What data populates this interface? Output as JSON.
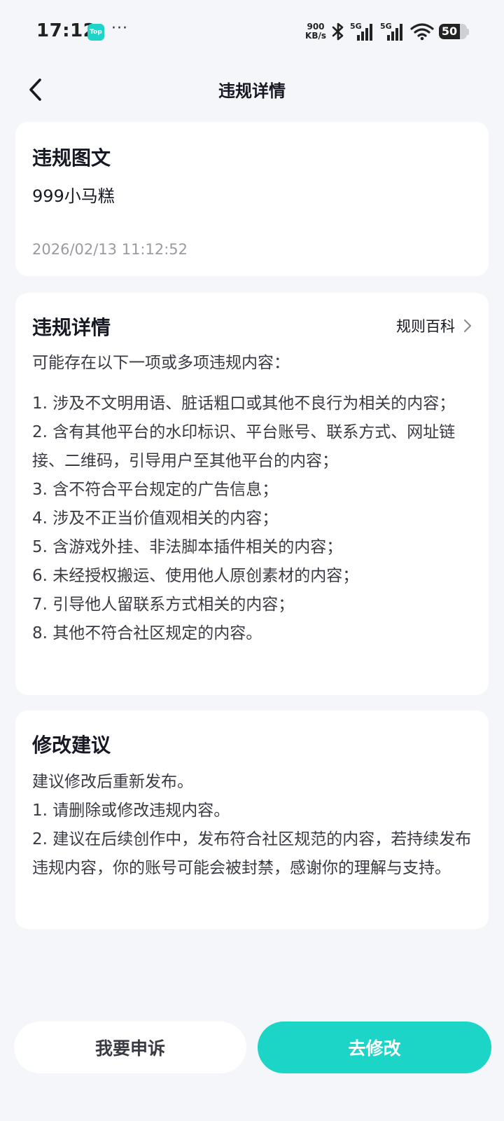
{
  "status_bar": {
    "time": "17:12",
    "top_badge": "Top",
    "more_dots": "···",
    "speed_value": "900",
    "speed_unit": "KB/s",
    "net_1": "5G",
    "net_2": "5G",
    "battery_level": "50"
  },
  "nav": {
    "title": "违规详情"
  },
  "violation_post": {
    "title": "违规图文",
    "name": "999小马糕",
    "time": "2026/02/13 11:12:52"
  },
  "violation_detail": {
    "title": "违规详情",
    "rules_link": "规则百科",
    "intro": "可能存在以下一项或多项违规内容：",
    "items": [
      "1. 涉及不文明用语、脏话粗口或其他不良行为相关的内容；",
      "2. 含有其他平台的水印标识、平台账号、联系方式、网址链接、二维码，引导用户至其他平台的内容；",
      "3. 含不符合平台规定的广告信息；",
      "4. 涉及不正当价值观相关的内容；",
      "5. 含游戏外挂、非法脚本插件相关的内容；",
      "6. 未经授权搬运、使用他人原创素材的内容；",
      "7. 引导他人留联系方式相关的内容；",
      "8. 其他不符合社区规定的内容。"
    ]
  },
  "suggestion": {
    "title": "修改建议",
    "intro": "建议修改后重新发布。",
    "items": [
      "1. 请删除或修改违规内容。",
      "2. 建议在后续创作中，发布符合社区规范的内容，若持续发布违规内容，你的账号可能会被封禁，感谢你的理解与支持。"
    ]
  },
  "actions": {
    "appeal_label": "我要申诉",
    "modify_label": "去修改"
  },
  "colors": {
    "accent": "#1dd5c6",
    "background": "#f5f6f9",
    "card": "#ffffff",
    "muted_text": "#9a9ba1"
  }
}
